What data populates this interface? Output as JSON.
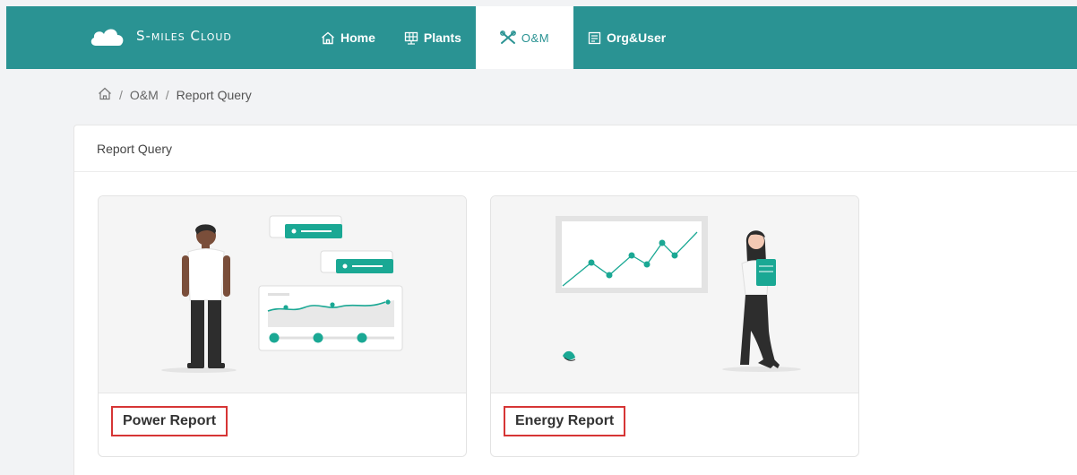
{
  "app": {
    "name": "S-miles Cloud"
  },
  "nav": {
    "home": "Home",
    "plants": "Plants",
    "om": "O&M",
    "org": "Org&User"
  },
  "breadcrumb": {
    "section": "O&M",
    "current": "Report Query"
  },
  "panel": {
    "title": "Report Query"
  },
  "cards": {
    "power": {
      "title": "Power Report"
    },
    "energy": {
      "title": "Energy Report"
    }
  },
  "colors": {
    "brand": "#2a9393",
    "accent": "#1aa894",
    "highlight": "#d63535"
  }
}
